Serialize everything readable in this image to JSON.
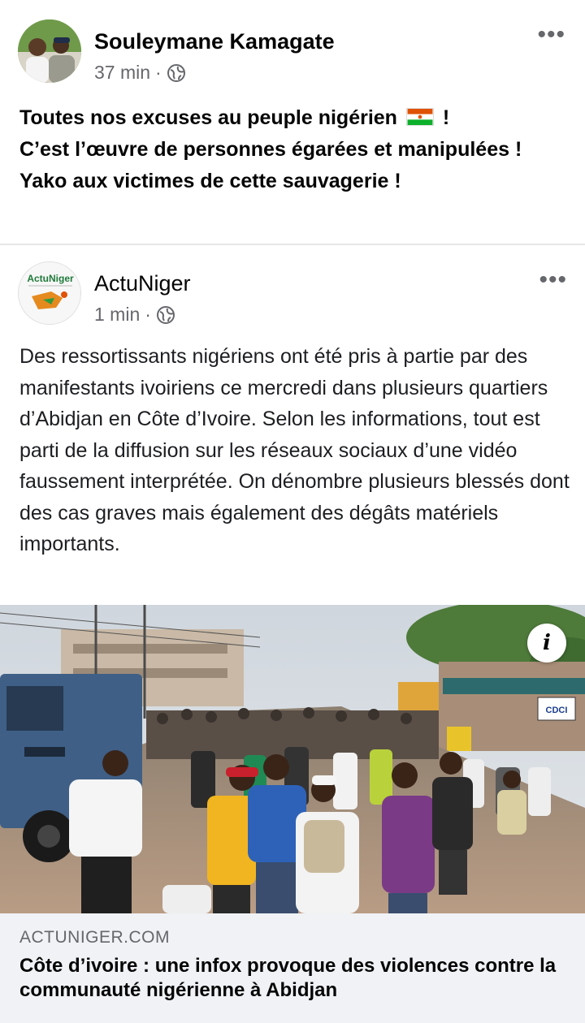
{
  "post": {
    "author": "Souleymane Kamagate",
    "time": "37 min",
    "separator": "·",
    "more": "•••",
    "lines": [
      "Toutes nos excuses au peuple nigérien",
      "!",
      "C’est l’œuvre de personnes égarées et manipulées  !",
      "Yako aux victimes de cette sauvagerie !"
    ],
    "flag_icon": "niger-flag-icon"
  },
  "shared": {
    "author": "ActuNiger",
    "time": "1 min",
    "separator": "·",
    "more": "•••",
    "avatar_text": "ActuNiger",
    "text": "Des ressortissants nigériens ont été pris à partie par des manifestants ivoiriens ce mercredi dans plusieurs quartiers d’Abidjan en Côte d’Ivoire. Selon les informations, tout est parti de la diffusion sur les réseaux sociaux d’une vidéo faussement interprétée. On dénombre plusieurs blessés dont des cas graves mais également des dégâts matériels importants."
  },
  "photo": {
    "info_label": "i",
    "sign_text": "CDCI"
  },
  "link": {
    "domain": "ACTUNIGER.COM",
    "title": "Côte d’ivoire : une infox provoque des violences contre la communauté nigérienne à Abidjan"
  },
  "colors": {
    "text": "#050505",
    "secondary": "#65676b",
    "card_bg": "#f0f2f5",
    "divider": "#e6e6e6"
  }
}
